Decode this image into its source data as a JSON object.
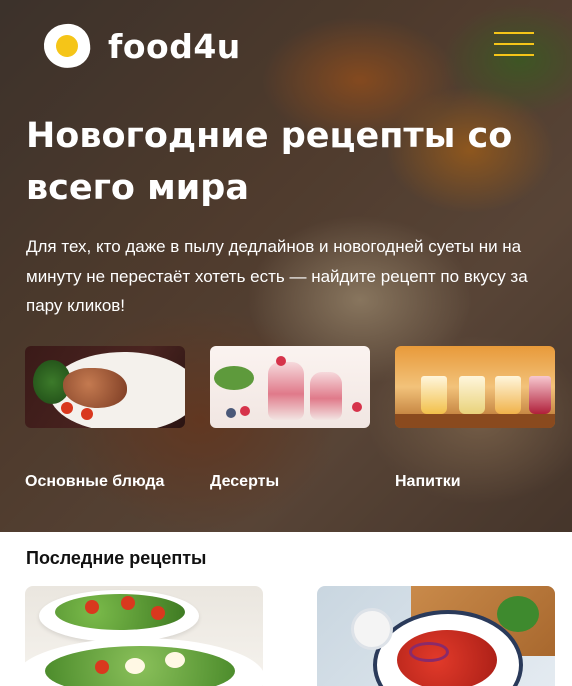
{
  "header": {
    "logo_text": "food4u",
    "logo_icon": "egg-icon",
    "menu_icon": "hamburger-menu-icon"
  },
  "hero": {
    "title": "Новогодние рецепты со всего мира",
    "subtitle": "Для тех, кто даже в пылу дедлайнов и новогодней суеты ни на минуту не перестаёт хотеть есть — найдите рецепт по вкусу за пару кликов!"
  },
  "categories": [
    {
      "label": "Основные блюда",
      "image": "main-dish-image"
    },
    {
      "label": "Десерты",
      "image": "dessert-image"
    },
    {
      "label": "Напитки",
      "image": "drinks-image"
    }
  ],
  "latest": {
    "title": "Последние рецепты",
    "cards": [
      {
        "image": "salad-image"
      },
      {
        "image": "tomato-salad-image"
      }
    ]
  },
  "colors": {
    "accent": "#f5c518",
    "text_light": "#ffffff",
    "text_dark": "#111111"
  }
}
